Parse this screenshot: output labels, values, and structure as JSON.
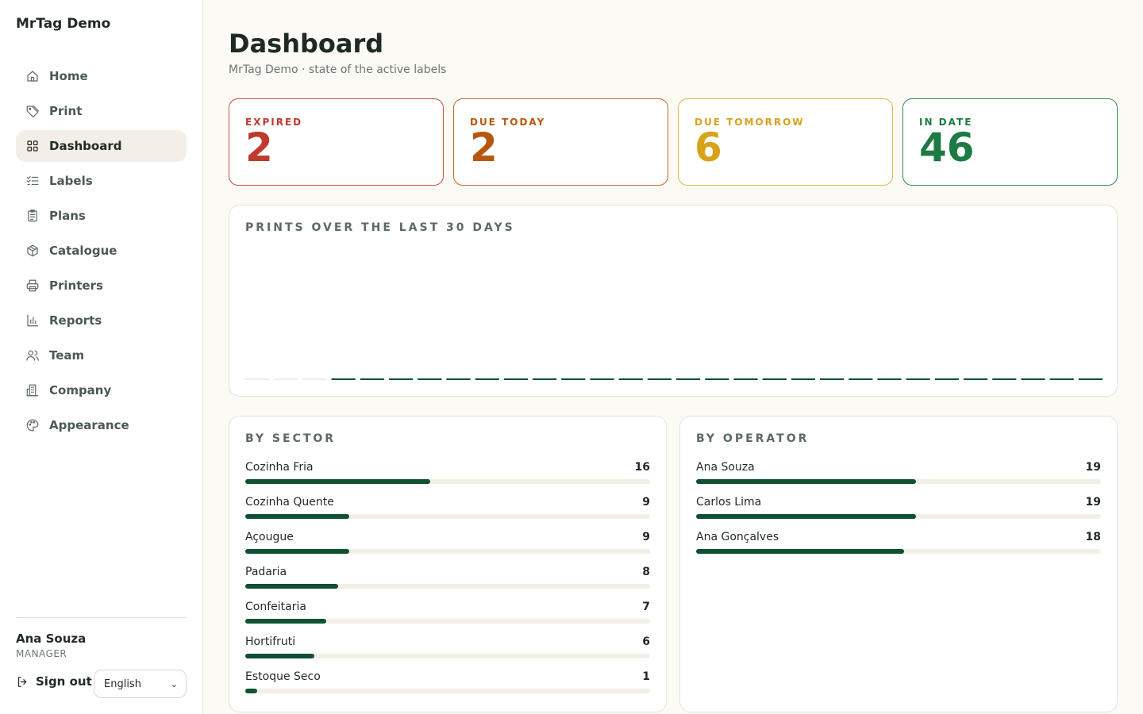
{
  "app": {
    "title": "MrTag Demo"
  },
  "sidebar": {
    "items": [
      {
        "label": "Home",
        "icon": "home-icon",
        "active": false
      },
      {
        "label": "Print",
        "icon": "tag-icon",
        "active": false
      },
      {
        "label": "Dashboard",
        "icon": "grid-icon",
        "active": true
      },
      {
        "label": "Labels",
        "icon": "checklist-icon",
        "active": false
      },
      {
        "label": "Plans",
        "icon": "clipboard-icon",
        "active": false
      },
      {
        "label": "Catalogue",
        "icon": "box-icon",
        "active": false
      },
      {
        "label": "Printers",
        "icon": "printer-icon",
        "active": false
      },
      {
        "label": "Reports",
        "icon": "bar-chart-icon",
        "active": false
      },
      {
        "label": "Team",
        "icon": "users-icon",
        "active": false
      },
      {
        "label": "Company",
        "icon": "building-icon",
        "active": false
      },
      {
        "label": "Appearance",
        "icon": "palette-icon",
        "active": false
      }
    ],
    "user": {
      "name": "Ana Souza",
      "role": "MANAGER"
    },
    "signout_label": "Sign out",
    "language": {
      "selected": "English"
    }
  },
  "main": {
    "title": "Dashboard",
    "subtitle": "MrTag Demo · state of the active labels",
    "stats": [
      {
        "label": "EXPIRED",
        "value": "2",
        "color": "#c0392b",
        "border": "#d24b3e"
      },
      {
        "label": "DUE TODAY",
        "value": "2",
        "color": "#b8560f",
        "border": "#c46a24"
      },
      {
        "label": "DUE TOMORROW",
        "value": "6",
        "color": "#d9a21b",
        "border": "#e2b53c"
      },
      {
        "label": "IN DATE",
        "value": "46",
        "color": "#1e7a45",
        "border": "#2e8a55"
      }
    ],
    "prints_panel": {
      "title": "PRINTS OVER THE LAST 30 DAYS"
    },
    "sector_panel": {
      "title": "BY SECTOR",
      "rows": [
        {
          "name": "Cozinha Fria",
          "count": "16",
          "value": 16
        },
        {
          "name": "Cozinha Quente",
          "count": "9",
          "value": 9
        },
        {
          "name": "Açougue",
          "count": "9",
          "value": 9
        },
        {
          "name": "Padaria",
          "count": "8",
          "value": 8
        },
        {
          "name": "Confeitaria",
          "count": "7",
          "value": 7
        },
        {
          "name": "Hortifruti",
          "count": "6",
          "value": 6
        },
        {
          "name": "Estoque Seco",
          "count": "1",
          "value": 1
        }
      ]
    },
    "operator_panel": {
      "title": "BY OPERATOR",
      "rows": [
        {
          "name": "Ana Souza",
          "count": "19",
          "value": 19
        },
        {
          "name": "Carlos Lima",
          "count": "19",
          "value": 19
        },
        {
          "name": "Ana Gonçalves",
          "count": "18",
          "value": 18
        }
      ]
    }
  },
  "chart_data": {
    "type": "bar",
    "values": [
      0,
      0,
      0,
      0,
      0,
      0,
      0,
      0,
      0,
      0,
      0,
      0,
      0,
      0,
      0,
      0,
      0,
      0,
      0,
      0,
      0,
      0,
      0,
      0,
      0,
      0,
      0,
      0,
      0,
      0
    ],
    "colors": {
      "empty": "#efece4",
      "filled": "#0f5132"
    },
    "empty_days": 3
  }
}
